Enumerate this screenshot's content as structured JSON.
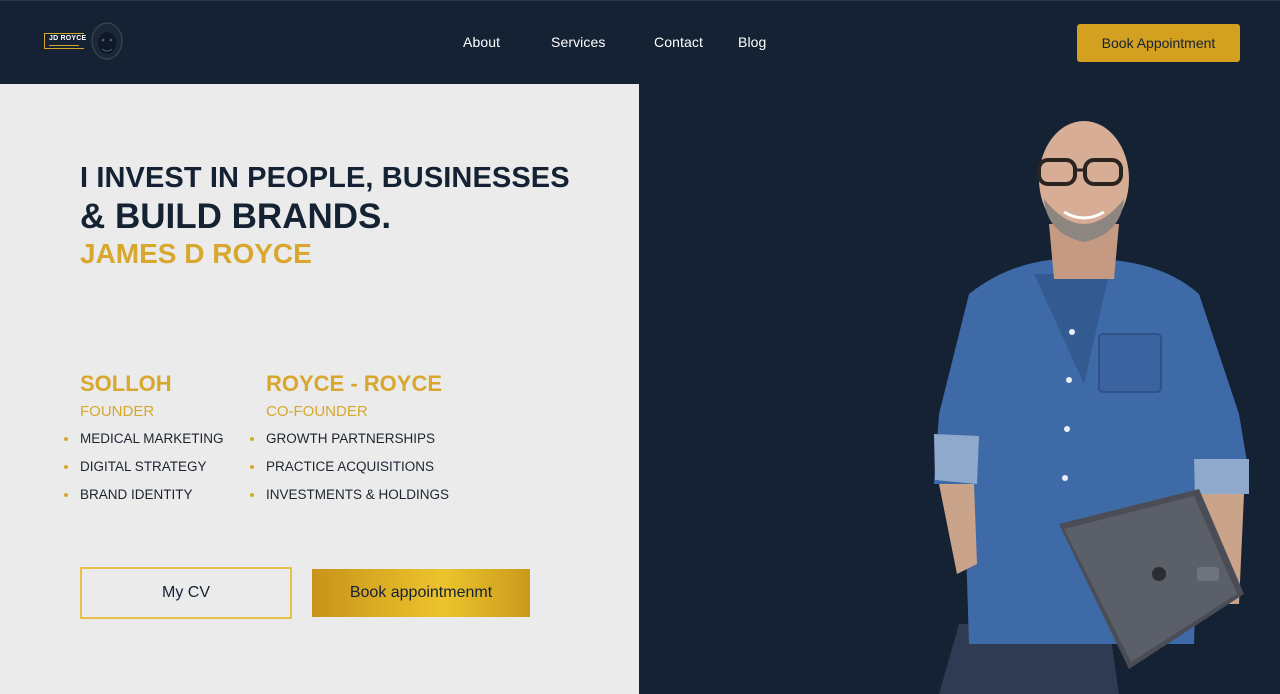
{
  "brand": {
    "logo_text": "JD ROYCE"
  },
  "nav": {
    "about": "About",
    "services": "Services",
    "contact": "Contact",
    "blog": "Blog"
  },
  "header_cta": "Book Appointment",
  "hero": {
    "line1": "I INVEST IN PEOPLE, BUSINESSES",
    "line2": "& BUILD BRANDS.",
    "name": "JAMES D ROYCE"
  },
  "ventures": [
    {
      "company": "SOLLOH",
      "role": "FOUNDER",
      "items": [
        "MEDICAL MARKETING",
        "DIGITAL STRATEGY",
        "BRAND IDENTITY"
      ]
    },
    {
      "company": "ROYCE - ROYCE",
      "role": "CO-FOUNDER",
      "items": [
        "GROWTH PARTNERSHIPS",
        "PRACTICE ACQUISITIONS",
        "INVESTMENTS & HOLDINGS"
      ]
    }
  ],
  "buttons": {
    "cv": "My CV",
    "book": "Book appointmenmt"
  },
  "colors": {
    "navy": "#142234",
    "gold": "#d8a82e",
    "panel": "#ebebeb"
  }
}
